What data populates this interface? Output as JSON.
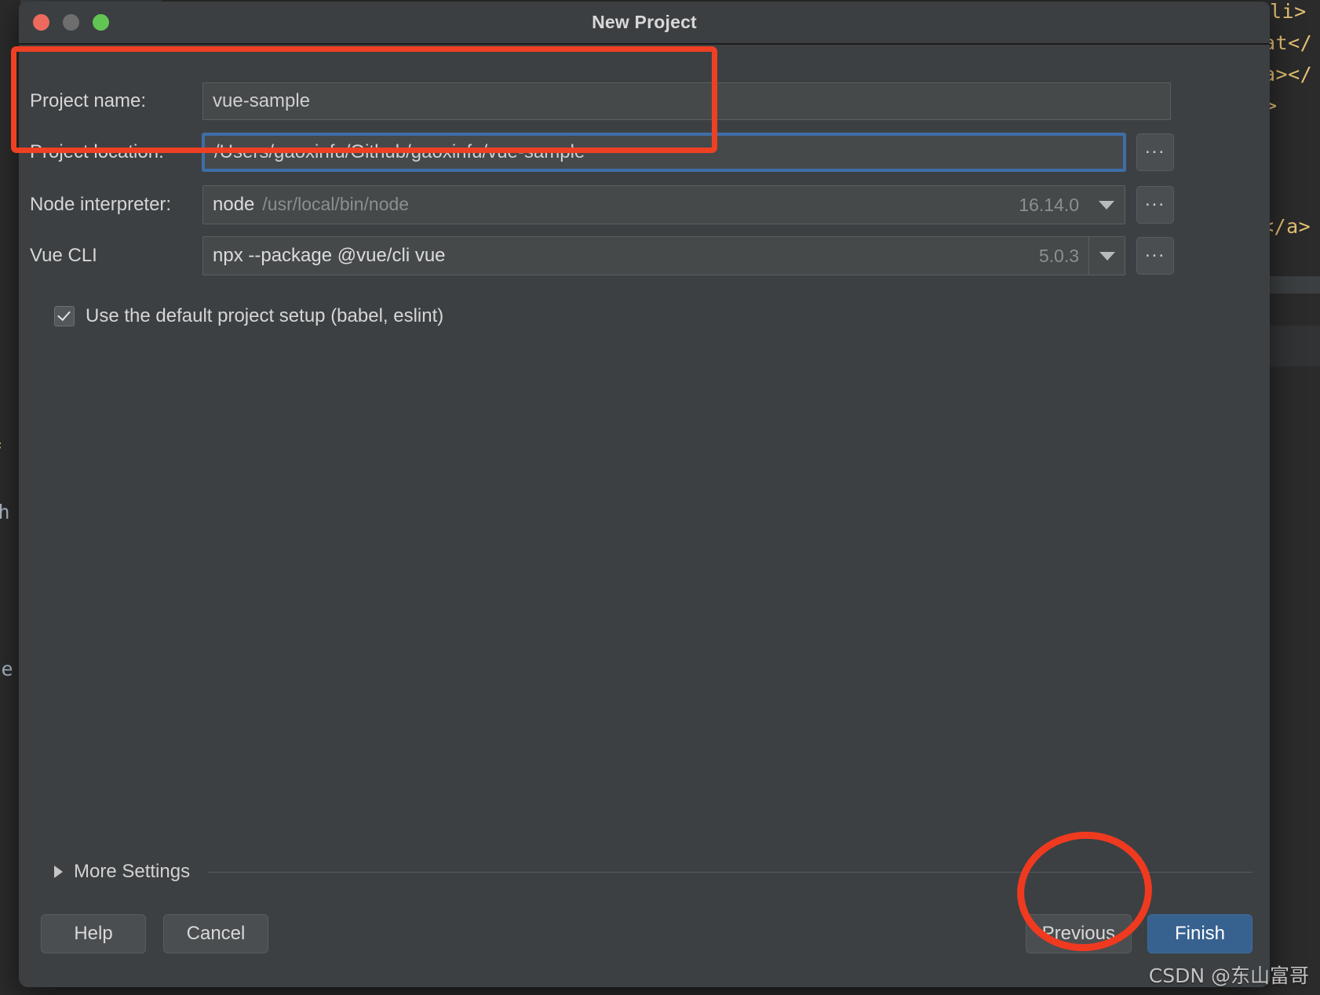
{
  "window": {
    "title": "New Project",
    "traffic_lights": [
      "close",
      "minimize",
      "maximize"
    ]
  },
  "form": {
    "project_name": {
      "label": "Project name:",
      "value": "vue-sample"
    },
    "project_location": {
      "label": "Project location:",
      "value": "/Users/gaoxinfu/Github/gaoxinfu/vue-sample",
      "browse_label": "..."
    },
    "node_interpreter": {
      "label": "Node interpreter:",
      "value": "node",
      "path": "/usr/local/bin/node",
      "version": "16.14.0",
      "browse_label": "..."
    },
    "vue_cli": {
      "label": "Vue CLI",
      "value": "npx --package @vue/cli vue",
      "version": "5.0.3",
      "browse_label": "..."
    },
    "default_setup": {
      "label": "Use the default project setup (babel, eslint)",
      "checked": true
    }
  },
  "more_settings": {
    "label": "More Settings",
    "expanded": false
  },
  "footer": {
    "help_label": "Help",
    "cancel_label": "Cancel",
    "previous_label": "Previous",
    "finish_label": "Finish"
  },
  "annotations": {
    "highlight_rect_note": "red rectangle around project name and location",
    "highlight_circle_note": "red circle around Finish button",
    "watermark": "CSDN @东山富哥"
  },
  "colors": {
    "accent_red": "#ef4023",
    "primary_button": "#37618f",
    "focus_border": "#3e6ea8",
    "dialog_bg": "#3c4043",
    "titlebar_bg": "#3c3f41"
  },
  "background_code": {
    "fragments": [
      "li>",
      "at</",
      "a></",
      ">",
      "</a>",
      "f",
      "gh",
      "le"
    ]
  }
}
